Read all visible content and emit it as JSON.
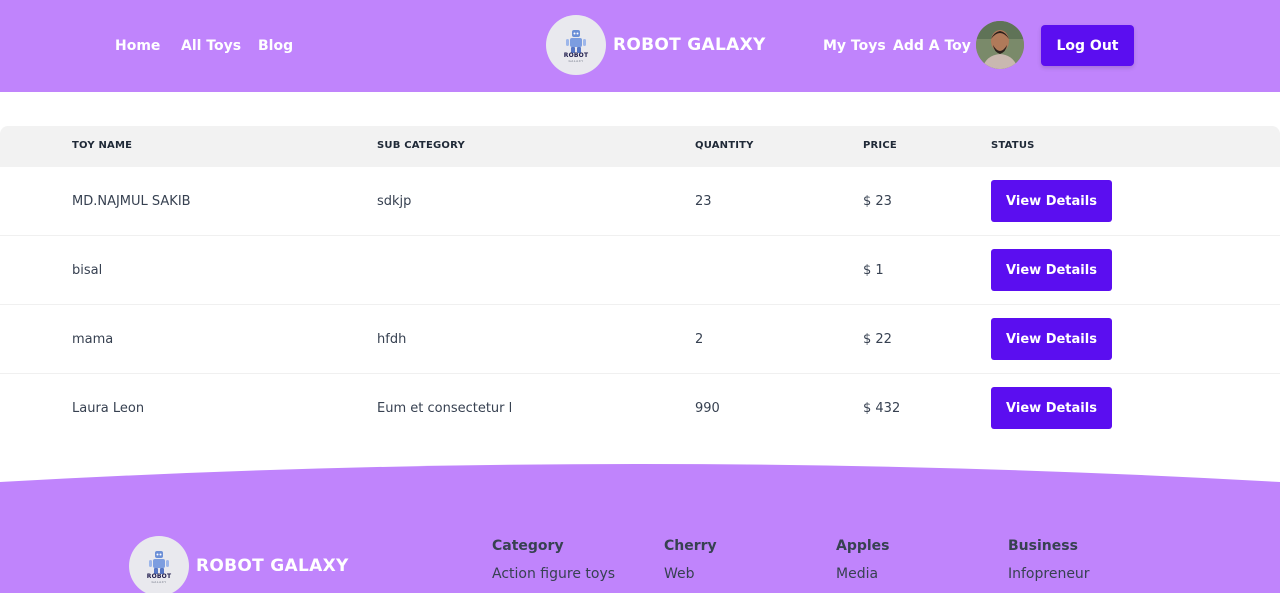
{
  "nav": {
    "home": "Home",
    "all_toys": "All Toys",
    "blog": "Blog",
    "my_toys": "My Toys",
    "add_toy": "Add A Toy",
    "logout": "Log Out"
  },
  "brand": {
    "name": "ROBOT GALAXY",
    "logo_word": "ROBOT",
    "logo_sub": "GALAXY"
  },
  "table": {
    "headers": [
      "TOY NAME",
      "SUB CATEGORY",
      "QUANTITY",
      "PRICE",
      "STATUS"
    ],
    "rows": [
      {
        "name": "MD.NAJMUL SAKIB",
        "sub_category": "sdkjp",
        "quantity": "23",
        "price": "$ 23",
        "action": "View Details"
      },
      {
        "name": "bisal",
        "sub_category": "",
        "quantity": "",
        "price": "$ 1",
        "action": "View Details"
      },
      {
        "name": "mama",
        "sub_category": "hfdh",
        "quantity": "2",
        "price": "$ 22",
        "action": "View Details"
      },
      {
        "name": "Laura Leon",
        "sub_category": "Eum et consectetur l",
        "quantity": "990",
        "price": "$ 432",
        "action": "View Details"
      }
    ]
  },
  "footer": {
    "brand_name": "ROBOT GALAXY",
    "columns": [
      {
        "title": "Category",
        "item": "Action figure toys"
      },
      {
        "title": "Cherry",
        "item": "Web"
      },
      {
        "title": "Apples",
        "item": "Media"
      },
      {
        "title": "Business",
        "item": "Infopreneur"
      }
    ]
  },
  "colors": {
    "header_bg": "#c084fc",
    "accent": "#5b0ef0",
    "table_header_bg": "#f2f2f2"
  }
}
